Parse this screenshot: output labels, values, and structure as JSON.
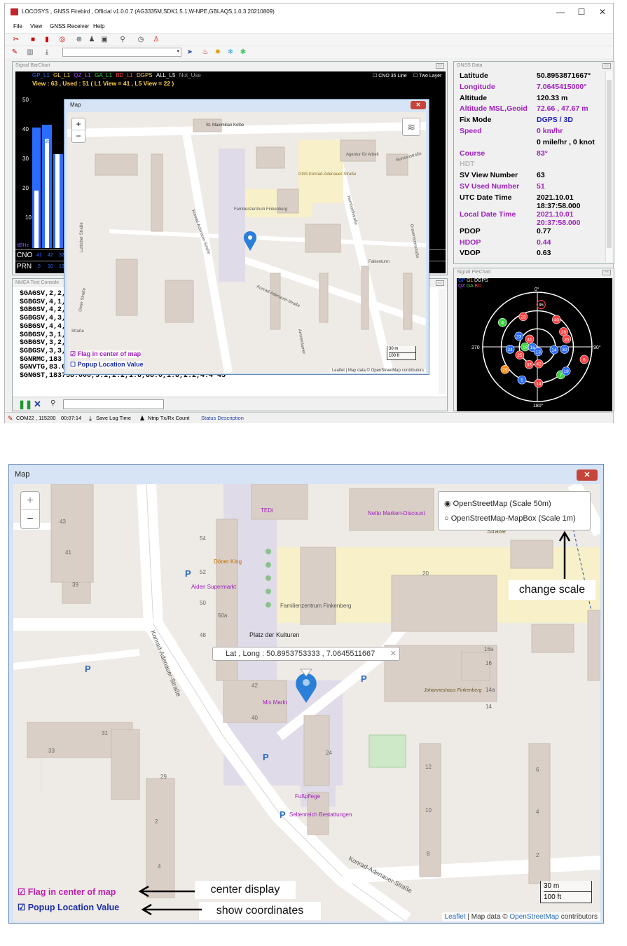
{
  "app": {
    "title": "LOCOSYS , GNSS Firebird , Official v1.0.0.7   (AG3335M,SDK1.5.1,W-NPE,GBLAQS,1.0.3.20210809)",
    "window_controls": [
      "—",
      "☐",
      "✕"
    ],
    "menu": [
      "File",
      "View",
      "GNSS Receiver",
      "Help"
    ]
  },
  "barchart": {
    "title": "Signal BarChart",
    "legend": [
      "GP_L1",
      "GL_L1",
      "QZ_L1",
      "GA_L1",
      "BD_L1",
      "DGPS",
      "ALL_L5",
      "Not_Use"
    ],
    "legend_colors": [
      "#2a6cff",
      "#ffd24a",
      "#b050ff",
      "#3fd23f",
      "#ff4040",
      "#ffffff",
      "#ffffff",
      "#aaaaaa"
    ],
    "status": "View : 63 ,  Used : 51  ( L1 View = 41  , L5 View = 22 )",
    "cno_line": "CNO 35 Line",
    "two_layer": "Two Layer",
    "y_ticks": [
      "50",
      "40",
      "30",
      "20",
      "10"
    ],
    "dbhz": "dBHz",
    "row_cno": "CNO",
    "row_prn": "PRN",
    "cno_values": [
      "41",
      "42",
      "32"
    ],
    "prn_values": [
      "5",
      "10",
      "13"
    ],
    "bar_label": "35"
  },
  "gnss": {
    "title": "GNSS Data",
    "rows": [
      {
        "label": "Latitude",
        "value": "50.8953871667°",
        "lc": "#000",
        "vc": "#000"
      },
      {
        "label": "Longitude",
        "value": "7.0645415000°",
        "lc": "#a020c0",
        "vc": "#a020c0"
      },
      {
        "label": "Altitude",
        "value": "120.33 m",
        "lc": "#000",
        "vc": "#000"
      },
      {
        "label": "Altitude MSL,Geoid",
        "value": "72.66 , 47.67 m",
        "lc": "#a020c0",
        "vc": "#a020c0"
      },
      {
        "label": "Fix Mode",
        "value": "DGPS  /  3D",
        "lc": "#000",
        "vc": "#2020c0"
      },
      {
        "label": "Speed",
        "value": "0 km/hr",
        "lc": "#a020c0",
        "vc": "#a020c0"
      },
      {
        "label": "",
        "value": "0 mile/hr , 0 knot",
        "lc": "#000",
        "vc": "#000"
      },
      {
        "label": "Course",
        "value": "83°",
        "lc": "#a020c0",
        "vc": "#a020c0"
      },
      {
        "label": "HDT",
        "value": "",
        "lc": "#bbb",
        "vc": "#bbb"
      },
      {
        "label": "SV View Number",
        "value": "63",
        "lc": "#000",
        "vc": "#000"
      },
      {
        "label": "SV Used Number",
        "value": "51",
        "lc": "#a020c0",
        "vc": "#a020c0"
      },
      {
        "label": "UTC Date Time",
        "value": "2021.10.01",
        "value2": "18:37:58.000",
        "lc": "#000",
        "vc": "#000"
      },
      {
        "label": "Local Date Time",
        "value": "2021.10.01",
        "value2": "20:37:58.000",
        "lc": "#a020c0",
        "vc": "#a020c0"
      },
      {
        "label": "PDOP",
        "value": "0.77",
        "lc": "#000",
        "vc": "#000"
      },
      {
        "label": "HDOP",
        "value": "0.44",
        "lc": "#a020c0",
        "vc": "#a020c0"
      },
      {
        "label": "VDOP",
        "value": "0.63",
        "lc": "#000",
        "vc": "#000"
      }
    ]
  },
  "pie": {
    "title": "Signal PieChart",
    "legend1": [
      "GP",
      "GL",
      "DGPS"
    ],
    "legend2": [
      "QZ",
      "GA",
      "BD"
    ],
    "dirs": {
      "n": "0°",
      "e": "90°",
      "s": "180°",
      "w": "270"
    },
    "sats": [
      {
        "id": "36",
        "az": 5,
        "el": 20,
        "c": "#ff4040",
        "used": false
      },
      {
        "id": "23",
        "az": 335,
        "el": 35,
        "c": "#ff4040",
        "used": true
      },
      {
        "id": "4",
        "az": 305,
        "el": 20,
        "c": "#3fd23f",
        "used": true
      },
      {
        "id": "40",
        "az": 35,
        "el": 35,
        "c": "#ff4040",
        "used": true
      },
      {
        "id": "26",
        "az": 60,
        "el": 40,
        "c": "#ff4040",
        "used": true
      },
      {
        "id": "35",
        "az": 75,
        "el": 40,
        "c": "#ff4040",
        "used": true
      },
      {
        "id": "23",
        "az": 300,
        "el": 55,
        "c": "#2a6cff",
        "used": true
      },
      {
        "id": "19",
        "az": 270,
        "el": 70,
        "c": "#3fd23f",
        "used": true
      },
      {
        "id": "16",
        "az": 265,
        "el": 82,
        "c": "#2a6cff",
        "used": true
      },
      {
        "id": "14",
        "az": 100,
        "el": 62,
        "c": "#2a6cff",
        "used": true
      },
      {
        "id": "30",
        "az": 95,
        "el": 45,
        "c": "#2a6cff",
        "used": true
      },
      {
        "id": "13",
        "az": 170,
        "el": 82,
        "c": "#2a6cff",
        "used": true
      },
      {
        "id": "24",
        "az": 265,
        "el": 45,
        "c": "#2a6cff",
        "used": true
      },
      {
        "id": "25",
        "az": 245,
        "el": 58,
        "c": "#ff4040",
        "used": true
      },
      {
        "id": "42",
        "az": 175,
        "el": 62,
        "c": "#ff4040",
        "used": true
      },
      {
        "id": "33",
        "az": 205,
        "el": 58,
        "c": "#ff4040",
        "used": true
      },
      {
        "id": "6",
        "az": 105,
        "el": 10,
        "c": "#ff4040",
        "used": true
      },
      {
        "id": "14",
        "az": 178,
        "el": 30,
        "c": "#ff4040",
        "used": true
      },
      {
        "id": "7",
        "az": 140,
        "el": 30,
        "c": "#3fd23f",
        "used": true
      },
      {
        "id": "19",
        "az": 130,
        "el": 28,
        "c": "#2a6cff",
        "used": true
      },
      {
        "id": "5",
        "az": 205,
        "el": 30,
        "c": "#2a6cff",
        "used": true
      },
      {
        "id": "29",
        "az": 235,
        "el": 25,
        "c": "#ff8c1a",
        "used": true
      },
      {
        "id": "41",
        "az": 315,
        "el": 72,
        "c": "#ff4040",
        "used": true
      }
    ]
  },
  "nmea": {
    "title": "NMEA Text Console",
    "lines": [
      "$GAGSV,2,2,0",
      "$GBGSV,4,1,1",
      "$GBGSV,4,2,1",
      "$GBGSV,4,3,",
      "$GBGSV,4,4,",
      "$GBGSV,3,1,0",
      "$GBGSV,3,2,0",
      "$GBGSV,3,3,0",
      "$GNRMC,183",
      "$GNVTG,83.6",
      "$GNGST,183758.000,3.1,2.2,1.8,88.0,1.8,2.2,4.4*43"
    ]
  },
  "status": {
    "port": "COM22 , 115200",
    "elapsed": "00:07:14",
    "save_log": "Save Log Time",
    "ntrip": "Ntrip Tx/Rx Count",
    "desc": "Status Description"
  },
  "small_map": {
    "title": "Map",
    "zoom_in": "+",
    "zoom_out": "−",
    "flag_label": "Flag in center of map",
    "popup_label": "Popup Location Value",
    "scale_m": "30 m",
    "scale_ft": "100 ft",
    "attribution": "Leaflet | Map data © OpenStreetMap contributors",
    "labels": [
      "St. Maximilian Kolbe",
      "Agentur für Arbeit",
      "Bunsenstraße",
      "GGS Konrad-Adenauer-Straße",
      "Familienzentrum Finkenberg",
      "Konrad-Adenauer-Straße",
      "Lutticher Straße",
      "Humboldtstraße",
      "Falkenturm",
      "Gravensteinstraße",
      "Ostpreußenstraße",
      "Amsterdamer",
      "Oster Straße",
      "Straße"
    ]
  },
  "big_map": {
    "title": "Map",
    "zoom_in": "+",
    "zoom_out": "−",
    "layers": [
      "OpenStreetMap (Scale 50m)",
      "OpenStreetMap-MapBox (Scale 1m)"
    ],
    "popup": "Lat , Long : 50.8953753333 , 7.0645511667",
    "popup_close": "✕",
    "flag_label": "Flag in center of map",
    "popup_label": "Popup Location Value",
    "scale_m": "30 m",
    "scale_ft": "100 ft",
    "attribution_leaflet": "Leaflet",
    "attribution_mid": " | Map data © ",
    "attribution_osm": "OpenStreetMap",
    "attribution_end": " contributors",
    "places": {
      "tedi": "TEDi",
      "netto": "Netto Marken-Discount",
      "doner": "Döner King",
      "aiden": "Aiden Supermarkt",
      "famz": "Familienzentrum Finkenberg",
      "platz": "Platz der Kulturen",
      "mix": "Mix Markt",
      "johannes": "Johanneshaus Finkenberg",
      "fuss": "Fußpflege",
      "selten": "Seltenreich Bestattungen",
      "strasse_top": "Straße",
      "kas1": "Konrad-Adenauer-Straße",
      "kas2": "Konrad-Adenauer-Straße"
    },
    "numbers": [
      "43",
      "41",
      "39",
      "54",
      "52",
      "50",
      "50a",
      "48",
      "42",
      "40",
      "31",
      "33",
      "29",
      "2",
      "4",
      "20",
      "16a",
      "16",
      "14a",
      "14",
      "24",
      "12",
      "10",
      "8",
      "6",
      "4",
      "2"
    ]
  },
  "annotations": {
    "change_scale": "change scale",
    "center_display": "center display",
    "show_coordinates": "show coordinates"
  }
}
